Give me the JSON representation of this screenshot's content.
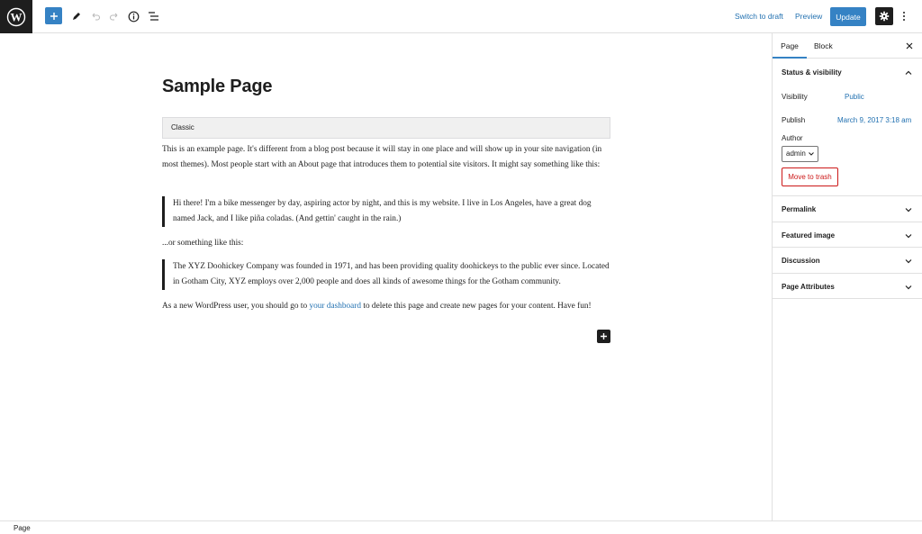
{
  "toolbar": {
    "logo_icon": "wordpress-logo-icon",
    "add_icon": "plus-icon",
    "tools_icon": "pencil-icon",
    "undo_icon": "undo-icon",
    "redo_icon": "redo-icon",
    "details_icon": "info-icon",
    "outline_icon": "list-view-icon",
    "switch_to_draft": "Switch to draft",
    "preview": "Preview",
    "update": "Update",
    "settings_icon": "gear-icon",
    "more_icon": "more-vertical-icon",
    "accent_color": "#3582c4"
  },
  "editor": {
    "title": "Sample Page",
    "classic_label": "Classic",
    "paragraph1": "This is an example page. It's different from a blog post because it will stay in one place and will show up in your site navigation (in most themes). Most people start with an About page that introduces them to potential site visitors. It might say something like this:",
    "quote1": "Hi there! I'm a bike messenger by day, aspiring actor by night, and this is my website. I live in Los Angeles, have a great dog named Jack, and I like piña coladas. (And gettin' caught in the rain.)",
    "paragraph2": "...or something like this:",
    "quote2": "The XYZ Doohickey Company was founded in 1971, and has been providing quality doohickeys to the public ever since. Located in Gotham City, XYZ employs over 2,000 people and does all kinds of awesome things for the Gotham community.",
    "paragraph3_before": "As a new WordPress user, you should go to ",
    "paragraph3_link": "your dashboard",
    "paragraph3_after": " to delete this page and create new pages for your content. Have fun!"
  },
  "sidebar": {
    "tabs": [
      "Page",
      "Block"
    ],
    "close_icon": "close-icon",
    "status_visibility": {
      "title": "Status & visibility",
      "visibility_label": "Visibility",
      "visibility_value": "Public",
      "publish_label": "Publish",
      "publish_value": "March 9, 2017 3:18 am",
      "author_label": "Author",
      "author_value": "admin",
      "trash_label": "Move to trash"
    },
    "panels": [
      "Permalink",
      "Featured image",
      "Discussion",
      "Page Attributes"
    ]
  },
  "footer": {
    "breadcrumb": "Page"
  }
}
